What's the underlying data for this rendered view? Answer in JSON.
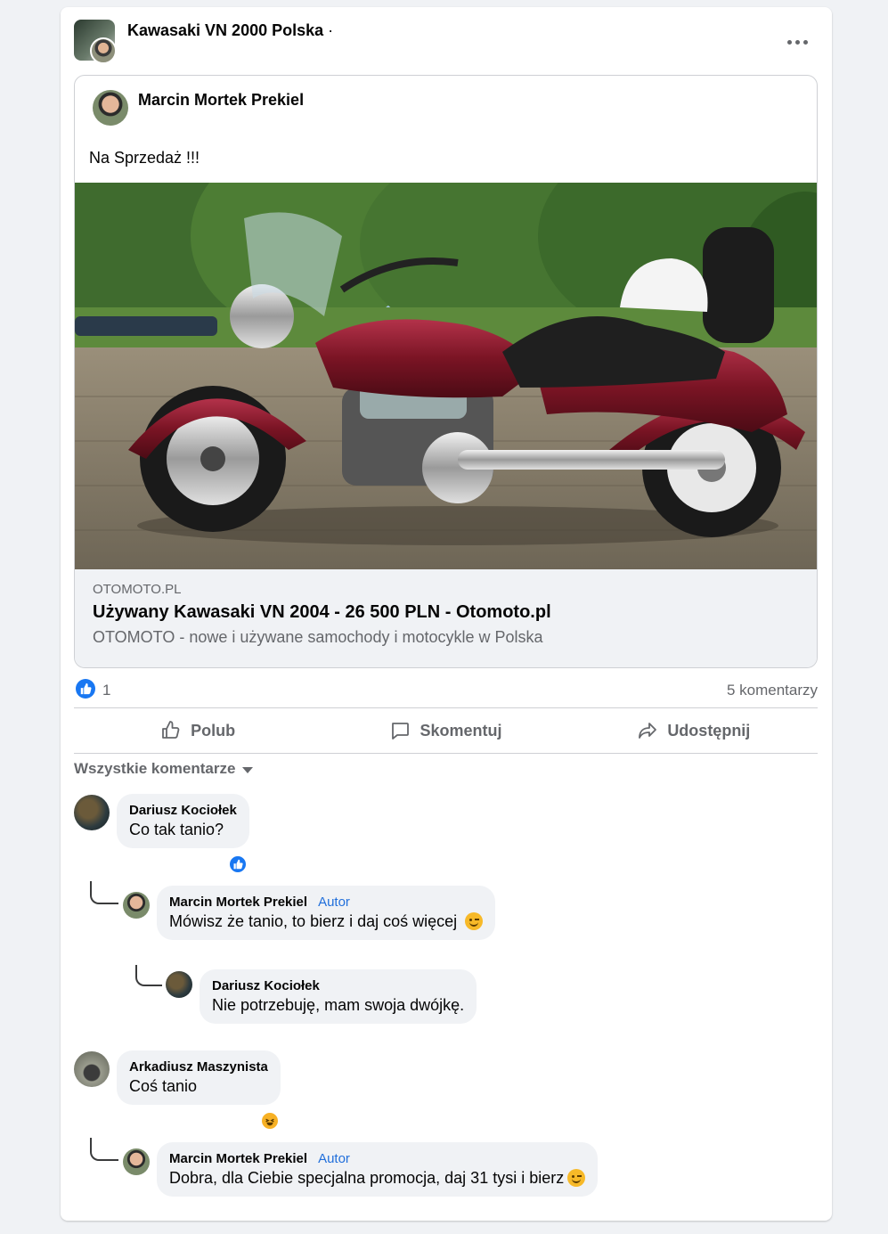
{
  "group": {
    "name": "Kawasaki VN 2000 Polska",
    "separator": "·"
  },
  "post": {
    "author": "Marcin Mortek Prekiel",
    "text": "Na Sprzedaż !!!",
    "link": {
      "domain": "OTOMOTO.PL",
      "title": "Używany Kawasaki VN 2004 - 26 500 PLN - Otomoto.pl",
      "description": "OTOMOTO - nowe i używane samochody i motocykle w Polska"
    },
    "reactions_count": "1",
    "comments_count": "5 komentarzy"
  },
  "actions": {
    "like": "Polub",
    "comment": "Skomentuj",
    "share": "Udostępnij"
  },
  "sort_label": "Wszystkie komentarze",
  "comments": [
    {
      "author": "Dariusz Kociołek",
      "text": "Co tak tanio?",
      "reaction": "like-icon"
    },
    {
      "author": "Marcin Mortek Prekiel",
      "badge": "Autor",
      "text": "Mówisz że tanio, to bierz i daj coś więcej",
      "emoji": "wink-emoji"
    },
    {
      "author": "Dariusz Kociołek",
      "text": "Nie potrzebuję, mam swoja dwójkę."
    },
    {
      "author": "Arkadiusz Maszynista",
      "text": "Coś tanio",
      "reaction": "haha-icon"
    },
    {
      "author": "Marcin Mortek Prekiel",
      "badge": "Autor",
      "text": "Dobra, dla Ciebie specjalna promocja, daj 31 tysi i bierz",
      "emoji": "wink-emoji"
    }
  ],
  "colors": {
    "accent": "#1877f2",
    "author_badge": "#216fdb",
    "bubble": "#f0f2f5",
    "muted": "#65676b"
  }
}
